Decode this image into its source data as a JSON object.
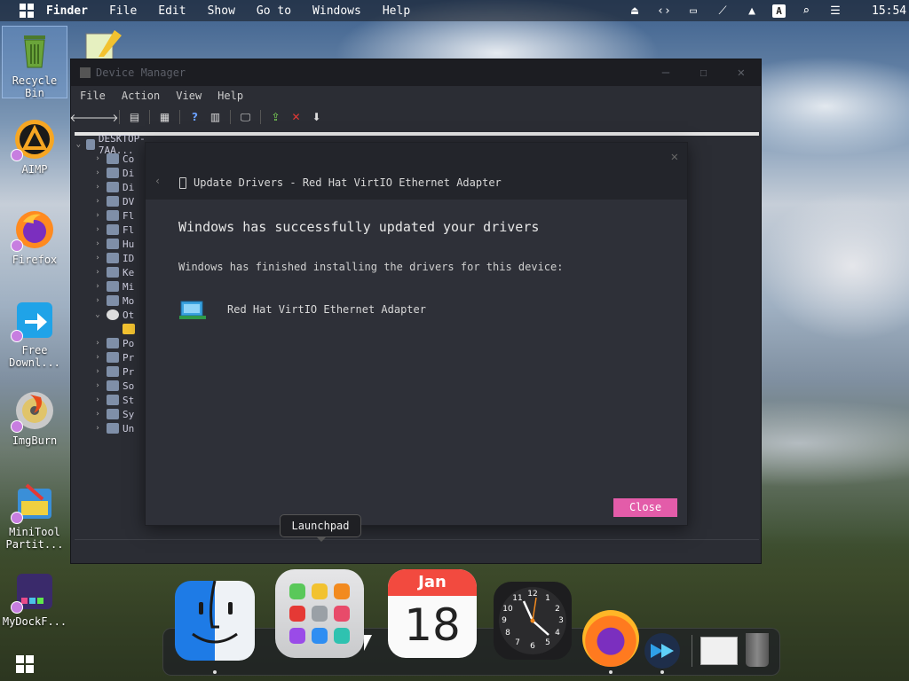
{
  "menubar": {
    "app": "Finder",
    "items": [
      "File",
      "Edit",
      "Show",
      "Go to",
      "Windows",
      "Help"
    ],
    "tray_input": "A",
    "clock": "15:54"
  },
  "desktop": {
    "icons": [
      {
        "label": "Recycle Bin"
      },
      {
        "label": "AIMP"
      },
      {
        "label": "Firefox"
      },
      {
        "label": "Free Downl..."
      },
      {
        "label": "ImgBurn"
      },
      {
        "label": "MiniTool Partit..."
      },
      {
        "label": "MyDockF..."
      }
    ]
  },
  "device_manager": {
    "title": "Device Manager",
    "menu": [
      "File",
      "Action",
      "View",
      "Help"
    ],
    "tree_root": "DESKTOP-7AA...",
    "tree_items": [
      "Co",
      "Di",
      "Di",
      "DV",
      "Fl",
      "Fl",
      "Hu",
      "ID",
      "Ke",
      "Mi",
      "Mo",
      "Ot",
      "",
      "Po",
      "Pr",
      "Pr",
      "So",
      "St",
      "Sy",
      "Un"
    ]
  },
  "dialog": {
    "title": "Update Drivers - Red Hat VirtIO Ethernet Adapter",
    "heading": "Windows has successfully updated your drivers",
    "message": "Windows has finished installing the drivers for this device:",
    "device": "Red Hat VirtIO Ethernet Adapter",
    "close_label": "Close"
  },
  "tooltip": {
    "label": "Launchpad"
  },
  "dock": {
    "calendar_month": "Jan",
    "calendar_day": "18",
    "clock_numbers": [
      "12",
      "1",
      "2",
      "3",
      "4",
      "5",
      "6",
      "7",
      "8",
      "9",
      "10",
      "11"
    ]
  },
  "colors": {
    "accent": "#e35ca9",
    "window_bg": "#2b2d34",
    "dialog_bg": "#2e3038"
  }
}
